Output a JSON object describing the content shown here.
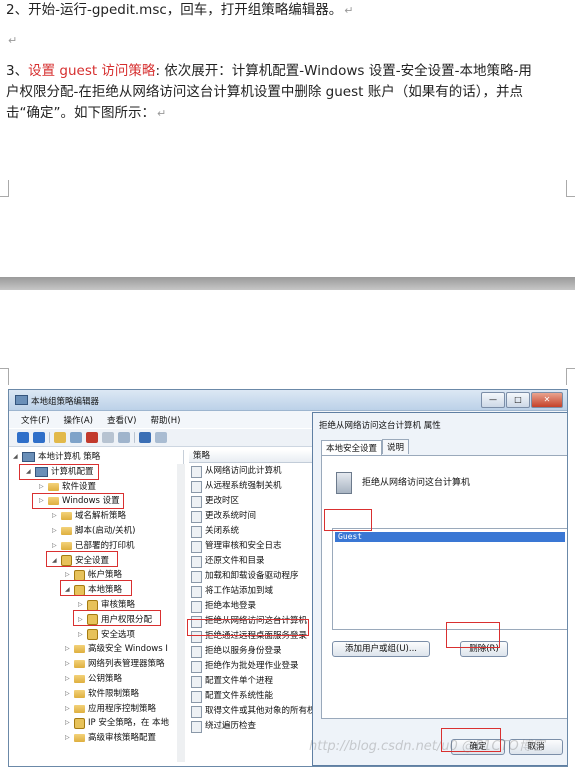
{
  "doc": {
    "step2": "2、开始-运行-gpedit.msc，回车，打开组策略编辑器。",
    "step3_prefix": "3、",
    "step3_link": "设置 guest 访问策略",
    "step3_rest": ": 依次展开：计算机配置-Windows 设置-安全设置-本地策略-用",
    "step3_line2": "户权限分配-在拒绝从网络访问这台计算机设置中删除 guest 账户（如果有的话），并点",
    "step3_line3": "击“确定”。如下图所示：",
    "para_mark": "↵"
  },
  "window": {
    "title": "本地组策略编辑器",
    "menu": [
      "文件(F)",
      "操作(A)",
      "查看(V)",
      "帮助(H)"
    ],
    "buttons": {
      "minimize": "—",
      "maximize": "□",
      "close": "✕"
    }
  },
  "tree": [
    {
      "label": "本地计算机 策略",
      "indent": 0,
      "icon": "pc"
    },
    {
      "label": "计算机配置",
      "indent": 1,
      "icon": "pc"
    },
    {
      "label": "软件设置",
      "indent": 2,
      "icon": "folder"
    },
    {
      "label": "Windows 设置",
      "indent": 2,
      "icon": "folder"
    },
    {
      "label": "域名解析策略",
      "indent": 3,
      "icon": "folder"
    },
    {
      "label": "脚本(启动/关机)",
      "indent": 3,
      "icon": "folder"
    },
    {
      "label": "已部署的打印机",
      "indent": 3,
      "icon": "folder"
    },
    {
      "label": "安全设置",
      "indent": 3,
      "icon": "lock"
    },
    {
      "label": "帐户策略",
      "indent": 4,
      "icon": "lock"
    },
    {
      "label": "本地策略",
      "indent": 4,
      "icon": "lock"
    },
    {
      "label": "审核策略",
      "indent": 5,
      "icon": "lock"
    },
    {
      "label": "用户权限分配",
      "indent": 5,
      "icon": "lock"
    },
    {
      "label": "安全选项",
      "indent": 5,
      "icon": "lock"
    },
    {
      "label": "高级安全 Windows I",
      "indent": 4,
      "icon": "folder"
    },
    {
      "label": "网络列表管理器策略",
      "indent": 4,
      "icon": "folder"
    },
    {
      "label": "公钥策略",
      "indent": 4,
      "icon": "folder"
    },
    {
      "label": "软件限制策略",
      "indent": 4,
      "icon": "folder"
    },
    {
      "label": "应用程序控制策略",
      "indent": 4,
      "icon": "folder"
    },
    {
      "label": "IP 安全策略，在 本地",
      "indent": 4,
      "icon": "lock"
    },
    {
      "label": "高级审核策略配置",
      "indent": 4,
      "icon": "folder"
    }
  ],
  "policy_header": "策略",
  "policies": [
    "从网络访问此计算机",
    "从远程系统强制关机",
    "更改时区",
    "更改系统时间",
    "关闭系统",
    "管理审核和安全日志",
    "还原文件和目录",
    "加载和卸载设备驱动程序",
    "将工作站添加到域",
    "拒绝本地登录",
    "拒绝从网络访问这台计算机",
    "拒绝通过远程桌面服务登录",
    "拒绝以服务身份登录",
    "拒绝作为批处理作业登录",
    "配置文件单个进程",
    "配置文件系统性能",
    "取得文件或其他对象的所有权",
    "绕过遍历检查"
  ],
  "dialog": {
    "title": "拒绝从网络访问这台计算机 属性",
    "tabs": [
      "本地安全设置",
      "说明"
    ],
    "policy_title": "拒绝从网络访问这台计算机",
    "list_item": "Guest",
    "add_button": "添加用户或组(U)...",
    "remove_button": "删除(R)",
    "ok_button": "确定",
    "cancel_button": "取消"
  },
  "watermark": "http://blog.csdn.net/u0  @51CTO博客"
}
